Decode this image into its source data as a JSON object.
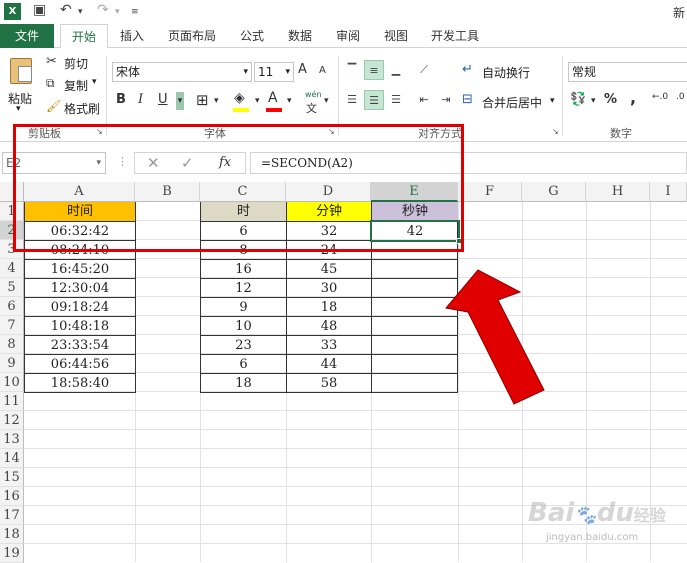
{
  "app": {
    "title_fragment": "新"
  },
  "tabs": [
    "文件",
    "开始",
    "插入",
    "页面布局",
    "公式",
    "数据",
    "审阅",
    "视图",
    "开发工具"
  ],
  "clipboard": {
    "paste": "粘贴",
    "cut": "剪切",
    "copy": "复制",
    "format_painter": "格式刷",
    "group": "剪贴板"
  },
  "font": {
    "name": "宋体",
    "size": "11",
    "grow": "A",
    "shrink": "A",
    "bold": "B",
    "italic": "I",
    "underline": "U",
    "font_color": "A",
    "wen": "wén",
    "group": "字体"
  },
  "alignment": {
    "wrap": "自动换行",
    "merge": "合并后居中",
    "group": "对齐方式"
  },
  "number": {
    "format": "常规",
    "percent": "%",
    "comma": ",",
    "group": "数字"
  },
  "formula_bar": {
    "name_box": "E2",
    "fx": "fx",
    "formula": "=SECOND(A2)"
  },
  "columns": [
    "A",
    "B",
    "C",
    "D",
    "E",
    "F",
    "G",
    "H",
    "I"
  ],
  "rows": [
    "1",
    "2",
    "3",
    "4",
    "5",
    "6",
    "7",
    "8",
    "9",
    "10",
    "11",
    "12",
    "13",
    "14",
    "15",
    "16",
    "17",
    "18",
    "19"
  ],
  "sheet": {
    "A1": "时间",
    "C1": "时",
    "D1": "分钟",
    "E1": "秒钟",
    "A": [
      "06:32:42",
      "08:24:10",
      "16:45:20",
      "12:30:04",
      "09:18:24",
      "10:48:18",
      "23:33:54",
      "06:44:56",
      "18:58:40"
    ],
    "C": [
      "6",
      "8",
      "16",
      "12",
      "9",
      "10",
      "23",
      "6",
      "18"
    ],
    "D": [
      "32",
      "24",
      "45",
      "30",
      "18",
      "48",
      "33",
      "44",
      "58"
    ],
    "E": [
      "42"
    ]
  },
  "watermark": {
    "brand": "Bai",
    "du": "du",
    "jingyan": "经验",
    "url": "jingyan.baidu.com"
  },
  "colors": {
    "header_A": "#ffc000",
    "header_C": "#ddd9c4",
    "header_D": "#ffff00",
    "header_E": "#ccc0da",
    "excel_green": "#217346",
    "annotation_red": "#e00000"
  }
}
